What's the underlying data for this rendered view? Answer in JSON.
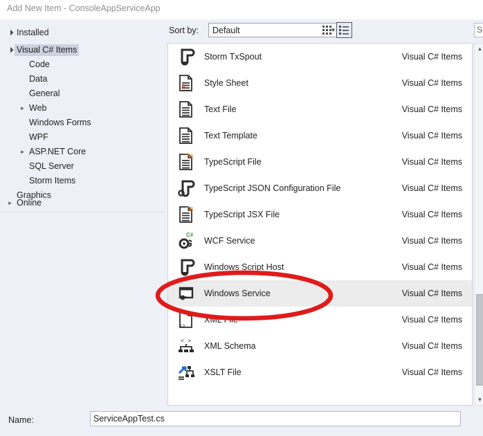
{
  "window": {
    "title": "Add New Item - ConsoleAppServiceApp"
  },
  "sidebar": {
    "installed": {
      "label": "Installed",
      "state": "expanded"
    },
    "online": {
      "label": "Online",
      "state": "collapsed"
    },
    "tree": [
      {
        "label": "Visual C# Items",
        "arrow": "open",
        "indent": 0,
        "selected": true
      },
      {
        "label": "Code",
        "arrow": "none",
        "indent": 1,
        "selected": false
      },
      {
        "label": "Data",
        "arrow": "none",
        "indent": 1,
        "selected": false
      },
      {
        "label": "General",
        "arrow": "none",
        "indent": 1,
        "selected": false
      },
      {
        "label": "Web",
        "arrow": "closed",
        "indent": 1,
        "selected": false
      },
      {
        "label": "Windows Forms",
        "arrow": "none",
        "indent": 1,
        "selected": false
      },
      {
        "label": "WPF",
        "arrow": "none",
        "indent": 1,
        "selected": false
      },
      {
        "label": "ASP.NET Core",
        "arrow": "closed",
        "indent": 1,
        "selected": false
      },
      {
        "label": "SQL Server",
        "arrow": "none",
        "indent": 1,
        "selected": false
      },
      {
        "label": "Storm Items",
        "arrow": "none",
        "indent": 1,
        "selected": false
      },
      {
        "label": "Graphics",
        "arrow": "none",
        "indent": 0,
        "selected": false
      }
    ]
  },
  "toolbar": {
    "sort_by_label": "Sort by:",
    "sort_by_value": "Default",
    "sort_by_options": [
      "Default"
    ],
    "view_tiles_name": "tiles-view",
    "view_list_name": "list-view",
    "view_selected": "list"
  },
  "search": {
    "visible_text": "S",
    "placeholder": "Search"
  },
  "list": {
    "category_column": "Visual C# Items",
    "selected_item": "Windows Service",
    "items": [
      {
        "name": "Storm TxSpout",
        "category": "Visual C# Items",
        "icon": "storm-spout-icon",
        "selected": false
      },
      {
        "name": "Style Sheet",
        "category": "Visual C# Items",
        "icon": "stylesheet-icon",
        "selected": false
      },
      {
        "name": "Text File",
        "category": "Visual C# Items",
        "icon": "text-file-icon",
        "selected": false
      },
      {
        "name": "Text Template",
        "category": "Visual C# Items",
        "icon": "text-template-icon",
        "selected": false
      },
      {
        "name": "TypeScript File",
        "category": "Visual C# Items",
        "icon": "typescript-file-icon",
        "selected": false
      },
      {
        "name": "TypeScript JSON Configuration File",
        "category": "Visual C# Items",
        "icon": "typescript-json-icon",
        "selected": false
      },
      {
        "name": "TypeScript JSX File",
        "category": "Visual C# Items",
        "icon": "typescript-jsx-icon",
        "selected": false
      },
      {
        "name": "WCF Service",
        "category": "Visual C# Items",
        "icon": "wcf-service-icon",
        "selected": false
      },
      {
        "name": "Windows Script Host",
        "category": "Visual C# Items",
        "icon": "script-host-icon",
        "selected": false
      },
      {
        "name": "Windows Service",
        "category": "Visual C# Items",
        "icon": "windows-service-icon",
        "selected": true
      },
      {
        "name": "XML File",
        "category": "Visual C# Items",
        "icon": "xml-file-icon",
        "selected": false
      },
      {
        "name": "XML Schema",
        "category": "Visual C# Items",
        "icon": "xml-schema-icon",
        "selected": false
      },
      {
        "name": "XSLT File",
        "category": "Visual C# Items",
        "icon": "xslt-file-icon",
        "selected": false
      }
    ]
  },
  "scrollbar": {
    "position": "near-bottom"
  },
  "footer": {
    "name_label": "Name:",
    "name_value": "ServiceAppTest.cs"
  },
  "annotation": {
    "shape": "ellipse",
    "color": "#e01b1b",
    "targets": "Windows Service"
  },
  "colors": {
    "panel_bg": "#eef0f7",
    "list_bg": "#ffffff",
    "selection": "#ececec",
    "tree_selection": "#cdd2e0",
    "annotation_red": "#e01b1b",
    "title_text": "#8e8e96"
  }
}
